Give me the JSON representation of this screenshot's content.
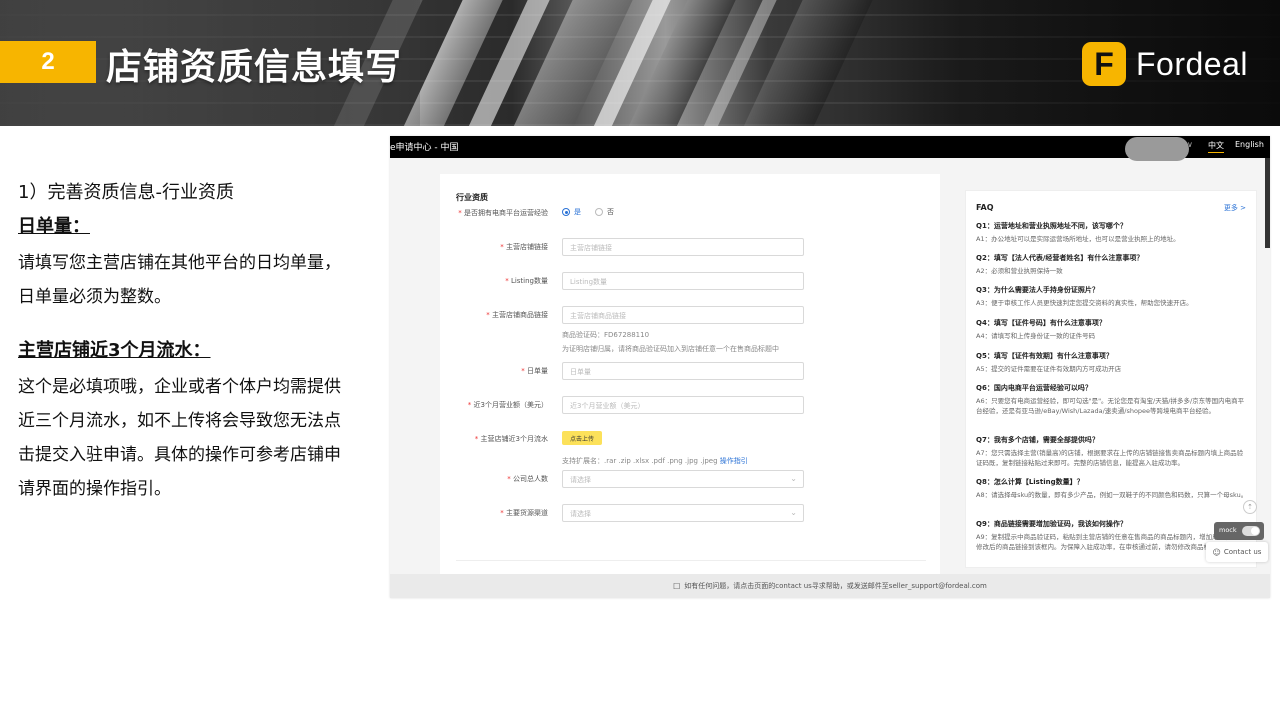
{
  "banner": {
    "section_number": "2",
    "title": "店铺资质信息填写",
    "logo_letter": "F",
    "logo_text": "Fordeal",
    "accent_color": "#f7b500"
  },
  "left": {
    "subtitle": "1）完善资质信息-行业资质",
    "heading1": "日单量：",
    "para1": "请填写您主营店铺在其他平台的日均单量，日单量必须为整数。",
    "heading2": "主营店铺近3个月流水：",
    "para2": "这个是必填项哦，企业或者个体户均需提供近三个月流水，如不上传将会导致您无法点击提交入驻申请。具体的操作可参考店铺申请界面的操作指引。"
  },
  "screenshot": {
    "topbar": {
      "title": "e申请中心 - 中国",
      "lang_zh": "中文",
      "lang_en": "English"
    },
    "form": {
      "title": "行业资质",
      "q_experience": "是否拥有电商平台运营经验",
      "opt_yes": "是",
      "opt_no": "否",
      "store_link_label": "主营店铺链接",
      "store_link_placeholder": "主营店铺链接",
      "listing_label": "Listing数量",
      "listing_placeholder": "Listing数量",
      "product_link_label": "主营店铺商品链接",
      "product_link_placeholder": "主营店铺商品链接",
      "verify_code": "商品验证码：FD67288110",
      "verify_hint": "为证明店铺归属，请将商品验证码加入到店铺任意一个在售商品标题中",
      "daily_label": "日单量",
      "daily_placeholder": "日单量",
      "revenue_label": "近3个月营业额（美元）",
      "revenue_placeholder": "近3个月营业额（美元）",
      "flow_label": "主营店铺近3个月流水",
      "upload_button": "点击上传",
      "ext_hint": "支持扩展名：.rar .zip .xlsx .pdf .png .jpg .jpeg",
      "guide_link": "操作指引",
      "staff_label": "公司总人数",
      "staff_placeholder": "请选择",
      "source_label": "主要货源渠道",
      "source_placeholder": "请选择"
    },
    "faq": {
      "title": "FAQ",
      "more": "更多 >",
      "items": [
        {
          "q": "Q1：运营地址和营业执照地址不同，该写哪个？",
          "a": "A1：办公地址可以是实际运营场所地址，也可以是营业执照上的地址。"
        },
        {
          "q": "Q2：填写【法人代表/经营者姓名】有什么注意事项？",
          "a": "A2：必须和营业执照保持一致"
        },
        {
          "q": "Q3：为什么需要法人手持身份证照片？",
          "a": "A3：便于审核工作人员更快速判定您提交资料的真实性，帮助您快速开店。"
        },
        {
          "q": "Q4：填写【证件号码】有什么注意事项？",
          "a": "A4：请填写和上传身份证一致的证件号码"
        },
        {
          "q": "Q5：填写【证件有效期】有什么注意事项？",
          "a": "A5：提交的证件需要在证件有效期内方可成功开店"
        },
        {
          "q": "Q6：国内电商平台运营经验可以吗？",
          "a": "A6：只要您有电商运营经验，即可勾选\"是\"。无论您是有淘宝/天猫/拼多多/京东等国内电商平台经验，还是有亚马逊/eBay/Wish/Lazada/速卖通/shopee等跨境电商平台经验。"
        },
        {
          "q": "Q7：我有多个店铺，需要全部提供吗？",
          "a": "A7：您只需选择主营(销量高)的店铺，根据要求在上传的店铺链接售卖商品标题内填上商品验证码既，复制链接粘贴过来即可。完整的店铺信息，能提高入驻成功率。"
        },
        {
          "q": "Q8：怎么计算【Listing数量】？",
          "a": "A8：请选择母sku的数量，即有多少产品，例如一双鞋子的不同颜色和码数，只算一个母sku。"
        },
        {
          "q": "Q9：商品链接需要增加验证码，我该如何操作？",
          "a": "A9：复制提示中商品验证码，粘贴到主营店铺的任意在售商品的商品标题内，增加成功，粘贴修改后的商品链接到该框内。为保障入驻成功率，在审核通过前，请勿修改商品标题。"
        }
      ]
    },
    "mock_label": "mock",
    "contact_label": "Contact us",
    "footer_text": "如有任何问题，请点击页面的contact us寻求帮助，或发送邮件至seller_support@fordeal.com"
  }
}
